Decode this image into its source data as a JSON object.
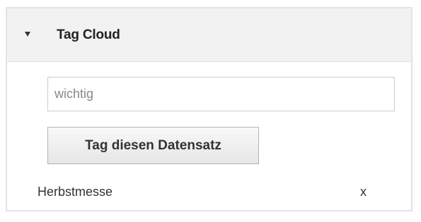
{
  "panel": {
    "title": "Tag Cloud",
    "caret_icon": "caret-down-icon"
  },
  "tag_form": {
    "input_value": "",
    "input_placeholder": "wichtig",
    "submit_label": "Tag diesen Datensatz"
  },
  "tags": [
    {
      "name": "Herbstmesse",
      "remove_label": "x"
    }
  ]
}
